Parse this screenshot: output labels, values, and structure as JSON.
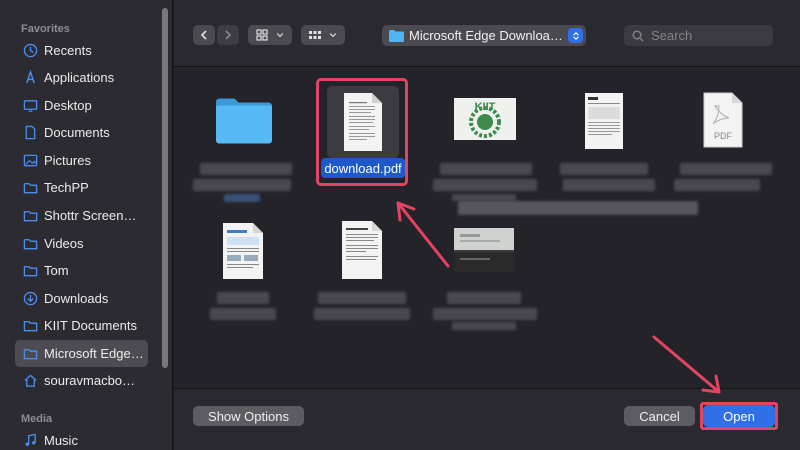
{
  "sidebar": {
    "favorites_heading": "Favorites",
    "media_heading": "Media",
    "items": [
      {
        "label": "Recents",
        "icon": "clock-icon"
      },
      {
        "label": "Applications",
        "icon": "applications-icon"
      },
      {
        "label": "Desktop",
        "icon": "desktop-icon"
      },
      {
        "label": "Documents",
        "icon": "document-icon"
      },
      {
        "label": "Pictures",
        "icon": "pictures-icon"
      },
      {
        "label": "TechPP",
        "icon": "folder-icon"
      },
      {
        "label": "Shottr Screen…",
        "icon": "folder-icon"
      },
      {
        "label": "Videos",
        "icon": "folder-icon"
      },
      {
        "label": "Tom",
        "icon": "folder-icon"
      },
      {
        "label": "Downloads",
        "icon": "download-icon"
      },
      {
        "label": "KIIT Documents",
        "icon": "folder-icon"
      },
      {
        "label": "Microsoft Edge…",
        "icon": "folder-icon",
        "selected": true
      },
      {
        "label": "souravmacbo…",
        "icon": "home-icon"
      }
    ],
    "media_items": [
      {
        "label": "Music",
        "icon": "music-icon"
      }
    ]
  },
  "toolbar": {
    "path_label": "Microsoft Edge Downloa…",
    "search_placeholder": "Search"
  },
  "files": {
    "selected_name": "download.pdf",
    "pdf_badge": "PDF",
    "kiit_logo_text": "KIIT"
  },
  "footer": {
    "show_options_label": "Show Options",
    "cancel_label": "Cancel",
    "open_label": "Open"
  },
  "colors": {
    "accent": "#2f6fe8",
    "annotation": "#e14561",
    "folder": "#4fb4f2"
  }
}
